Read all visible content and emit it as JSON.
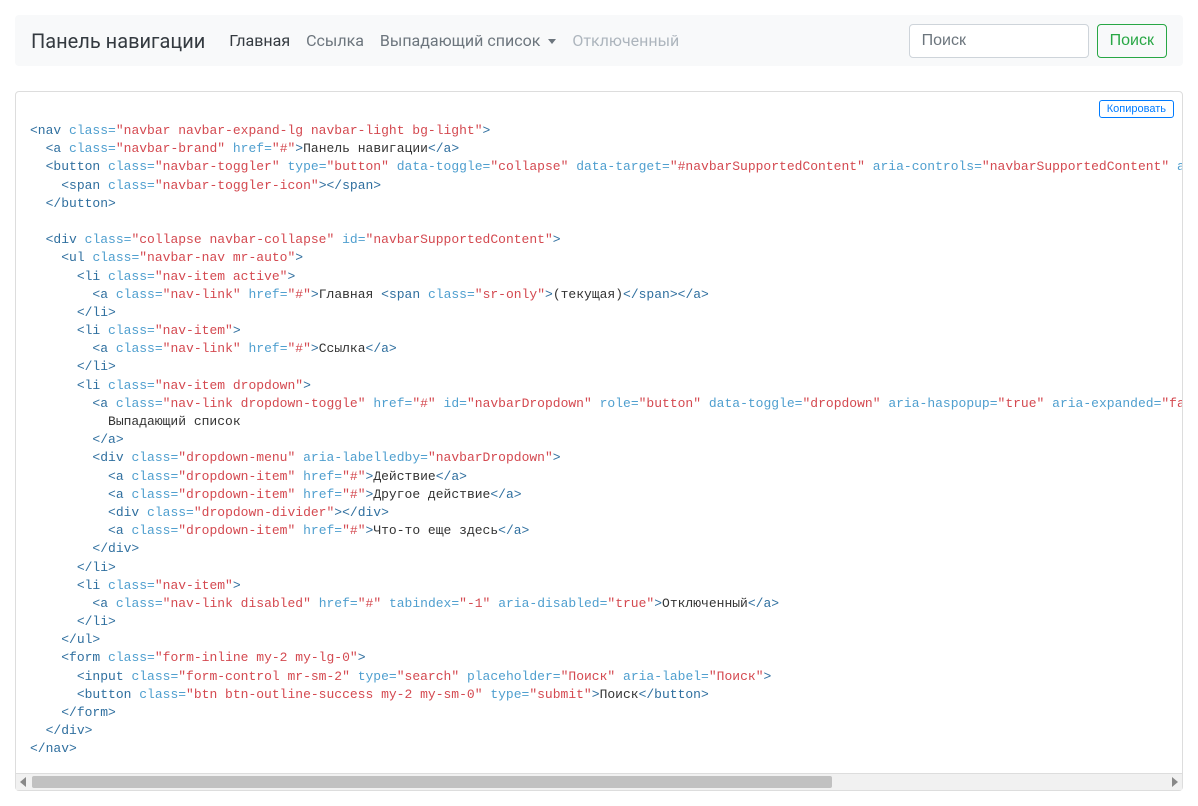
{
  "navbar": {
    "brand": "Панель навигации",
    "items": [
      {
        "label": "Главная",
        "state": "active"
      },
      {
        "label": "Ссылка",
        "state": "normal"
      },
      {
        "label": "Выпадающий список",
        "state": "dropdown"
      },
      {
        "label": "Отключенный",
        "state": "disabled"
      }
    ],
    "search_placeholder": "Поиск",
    "search_button": "Поиск"
  },
  "copy_button": "Копировать",
  "code": {
    "brand_text": "Панель навигации",
    "dropdown_label": "Выпадающий список",
    "sr_only_text": "(текущая)",
    "nav_home": "Главная ",
    "nav_link": "Ссылка",
    "nav_disabled": "Отключенный",
    "dd_action": "Действие",
    "dd_other": "Другое действие",
    "dd_something": "Что-то еще здесь",
    "search_placeholder": "Поиск",
    "search_aria": "Поиск",
    "search_btn": "Поиск",
    "navbar_id": "navbarSupportedContent",
    "dropdown_id": "navbarDropdown"
  }
}
